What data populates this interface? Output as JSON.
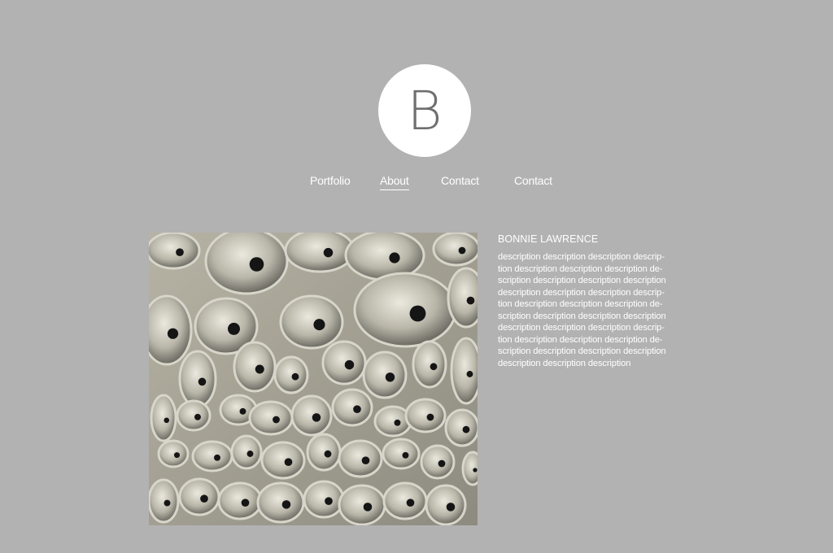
{
  "logo": {
    "letter": "B"
  },
  "nav": {
    "items": [
      {
        "label": "Portfolio"
      },
      {
        "label": "About"
      },
      {
        "label": "Contact"
      },
      {
        "label": "Contact"
      }
    ]
  },
  "profile": {
    "name": "BONNIE LAWRENCE",
    "description": "description description description descrip-\ntion description description description de-\nscription description description description\ndescription description description descrip-\ntion description description description de-\nscription description description description\ndescription description description descrip-\ntion description description description de-\nscription description description description\ndescription description description"
  },
  "colors": {
    "background": "#b2b2b2",
    "logo_circle": "#ffffff",
    "logo_letter": "#6f6f6f",
    "text": "#ffffff"
  }
}
